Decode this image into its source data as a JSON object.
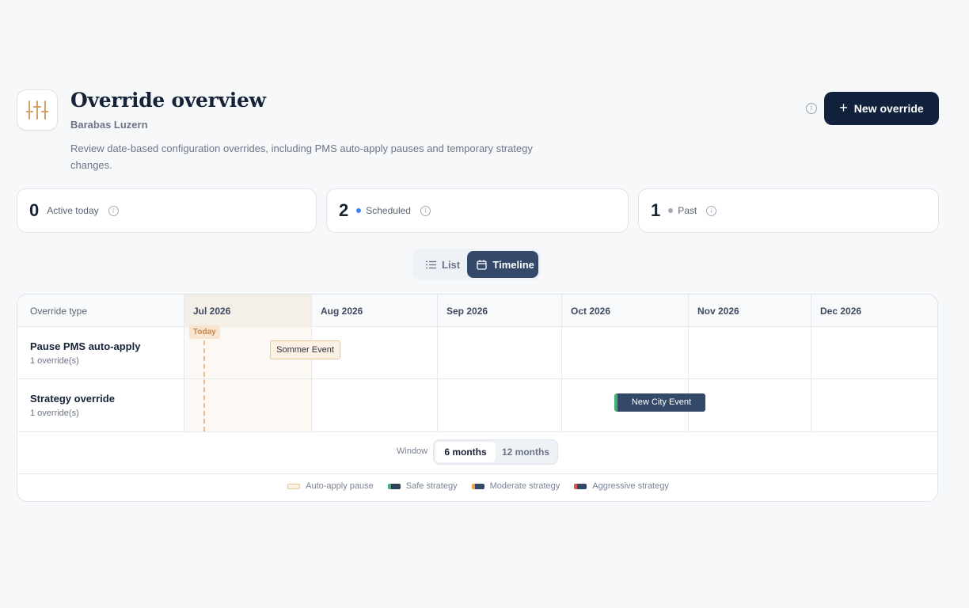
{
  "header": {
    "title": "Override overview",
    "subtitle": "Barabas Luzern",
    "description": "Review date-based configuration overrides, including PMS auto-apply pauses and temporary strategy changes.",
    "new_button_label": "New override",
    "icon": "sliders-icon"
  },
  "stats": [
    {
      "count": "0",
      "label": "Active today"
    },
    {
      "count": "2",
      "label": "Scheduled",
      "dot_color": "#3b82f6"
    },
    {
      "count": "1",
      "label": "Past",
      "dot_color": "#a2aab8"
    }
  ],
  "view_toggle": {
    "list_label": "List",
    "timeline_label": "Timeline",
    "selected": "Timeline"
  },
  "timeline": {
    "type_header": "Override type",
    "months": [
      "Jul 2026",
      "Aug 2026",
      "Sep 2026",
      "Oct 2026",
      "Nov 2026",
      "Dec 2026"
    ],
    "today_label": "Today",
    "rows": [
      {
        "name": "Pause PMS auto-apply",
        "count": "1 override(s)",
        "event": "Sommer Event"
      },
      {
        "name": "Strategy override",
        "count": "1 override(s)",
        "event": "New City Event"
      }
    ],
    "window": {
      "label": "Window",
      "options": [
        "6 months",
        "12 months"
      ],
      "selected": "6 months"
    },
    "legend": [
      "Auto-apply pause",
      "Safe strategy",
      "Moderate strategy",
      "Aggressive strategy"
    ]
  },
  "colors": {
    "primary": "#13223c",
    "accent": "#c9965f",
    "strategy_bar": "#34496a",
    "safe": "#3fae7a"
  }
}
